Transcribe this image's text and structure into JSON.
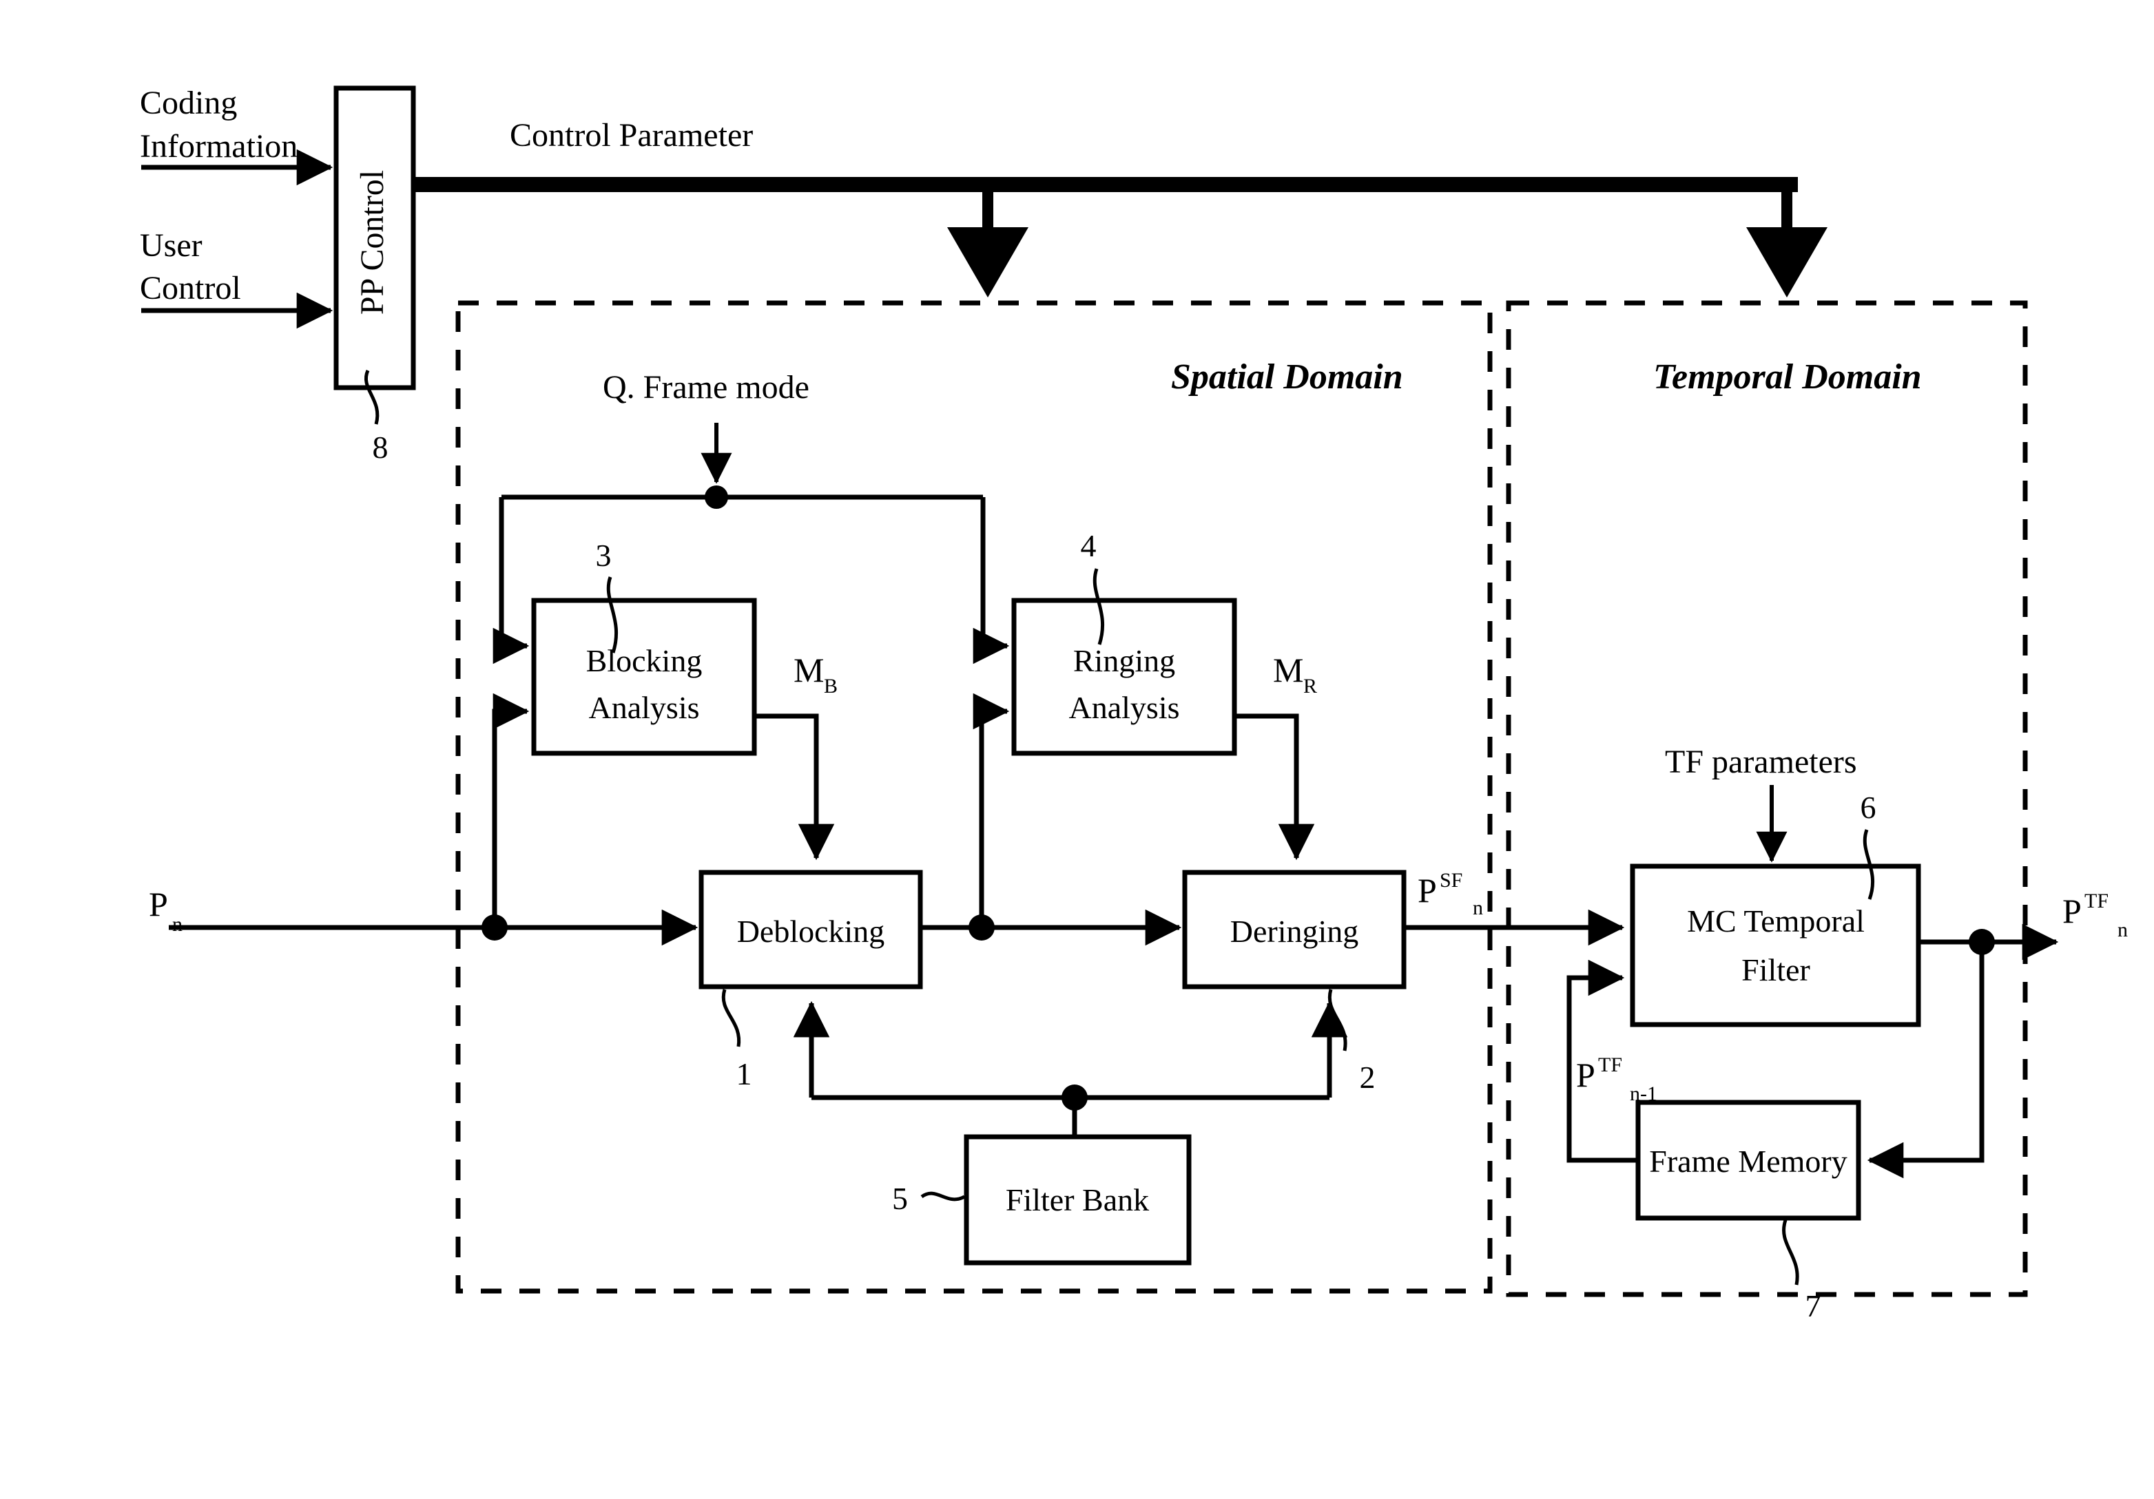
{
  "figure": {
    "type": "block-diagram",
    "title": "Video post-processing block diagram"
  },
  "inputs": {
    "coding_information_line1": "Coding",
    "coding_information_line2": "Information",
    "user_control_line1": "User",
    "user_control_line2": "Control",
    "control_parameter": "Control Parameter",
    "q_frame_mode": "Q. Frame mode",
    "tf_parameters": "TF parameters"
  },
  "regions": {
    "spatial": "Spatial Domain",
    "temporal": "Temporal Domain"
  },
  "blocks": {
    "pp_control": {
      "label": "PP Control",
      "ref": "8"
    },
    "blocking_analysis": {
      "line1": "Blocking",
      "line2": "Analysis",
      "ref": "3"
    },
    "ringing_analysis": {
      "line1": "Ringing",
      "line2": "Analysis",
      "ref": "4"
    },
    "deblocking": {
      "label": "Deblocking",
      "ref": "1"
    },
    "deringing": {
      "label": "Deringing",
      "ref": "2"
    },
    "filter_bank": {
      "label": "Filter Bank",
      "ref": "5"
    },
    "mc_temporal_filter": {
      "line1": "MC Temporal",
      "line2": "Filter",
      "ref": "6"
    },
    "frame_memory": {
      "label": "Frame Memory",
      "ref": "7"
    }
  },
  "signals": {
    "p_in_base": "P",
    "p_in_sub": "n",
    "mask_blocking_base": "M",
    "mask_blocking_sub": "B",
    "mask_ringing_base": "M",
    "mask_ringing_sub": "R",
    "p_sf_base": "P",
    "p_sf_sup": "SF",
    "p_sf_sub": "n",
    "p_tf_out_base": "P",
    "p_tf_out_sup": "TF",
    "p_tf_out_sub": "n",
    "p_tf_prev_base": "P",
    "p_tf_prev_sup": "TF",
    "p_tf_prev_sub": "n-1"
  },
  "colors": {
    "stroke": "#000000",
    "background": "#ffffff"
  }
}
